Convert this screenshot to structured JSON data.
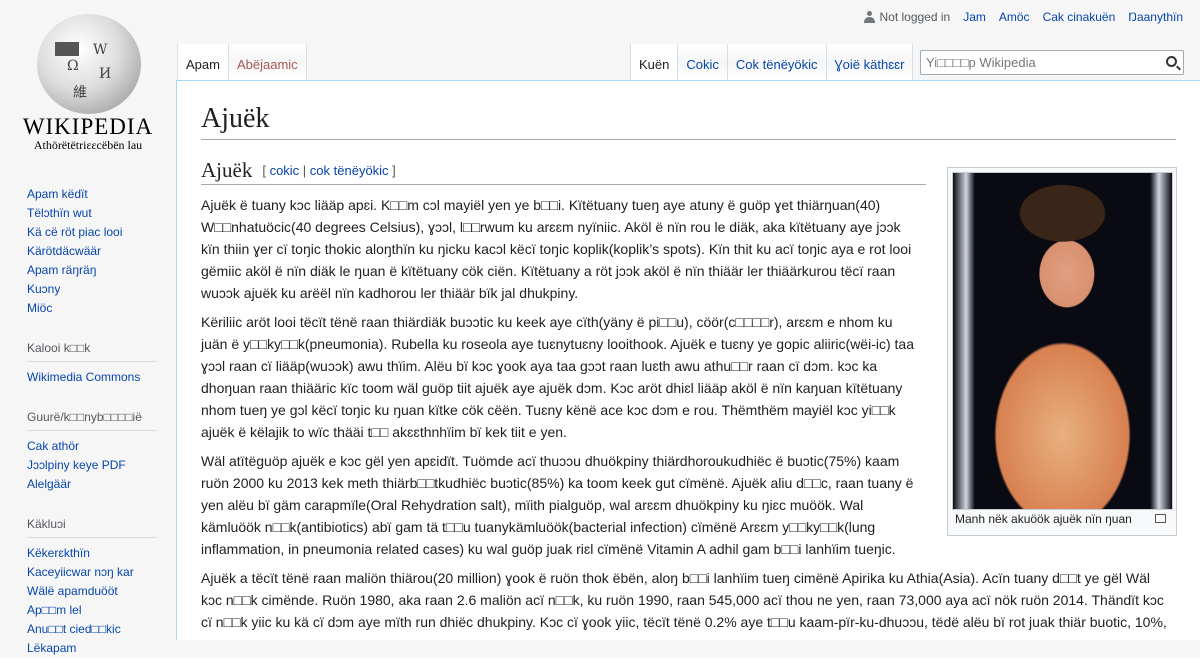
{
  "logo": {
    "wordmark": "WIKIPEDIA",
    "tagline": "Athörëtëtriɛɛcëbën lau"
  },
  "user_bar": {
    "not_logged_in": "Not logged in",
    "links": [
      "Jam",
      "Amöc",
      "Cak cinakuën",
      "Ŋaanythïn"
    ]
  },
  "left_tabs": [
    {
      "label": "Apam",
      "selected": true
    },
    {
      "label": "Abëjaamic",
      "selected": false
    }
  ],
  "right_tabs": [
    {
      "label": "Kuën",
      "selected": true
    },
    {
      "label": "Cokic"
    },
    {
      "label": "Cok tënëyökic"
    },
    {
      "label": "Ɣoië käthɛɛr"
    }
  ],
  "search": {
    "placeholder": "Yi□□□□p Wikipedia"
  },
  "sidebar": {
    "nav": [
      "Apam këdït",
      "Tëlɔthïn wut",
      "Kä cë röt piac looi",
      "Kärötdäcwäär",
      "Apam räŋräŋ",
      "Kuɔny",
      "Miöc"
    ],
    "sections": [
      {
        "heading": "Kalooi k□□k",
        "items": [
          "Wikimedia Commons"
        ]
      },
      {
        "heading": "Guurë/k□□nyb□□□□ië",
        "items": [
          "Cak athör",
          "Jɔɔlpiny keye PDF",
          "Alelgäär"
        ]
      },
      {
        "heading": "Käkluɔi",
        "items": [
          "Këkerɛkthïn",
          "Kaceyiicwar nɔŋ kar",
          "Wälë apamduööt",
          "Ap□□m lel",
          "Anu□□t cied□□kic",
          "Lëkapam"
        ]
      }
    ]
  },
  "article": {
    "title": "Ajuëk",
    "section_heading": "Ajuëk",
    "edit_links": {
      "edit": "cokic",
      "edit_source": "cok tënëyökic"
    },
    "paragraphs": [
      [
        "Ajuëk ë tuany kɔc liääp apɛi. K□□m cɔl mayiël yen ye b□□i. Kïtëtuany tueŋ aye atuny ë guöp ɣet thiärŋuan(40)",
        "W□□nhatuöcic(40 degrees Celsius), ɣɔɔl, l□□rwum ku arɛɛm nyïniic. Aköl ë nïn rou le diäk, aka kïtëtuany aye jɔɔk",
        "kïn thiin ɣer cï toŋic thokic aloŋthïn ku ŋicku kacɔl këcï toŋic koplik(koplik’s spots). Kïn thit ku acï toŋic aya e rot looi",
        "gëmiic aköl ë nïn diäk le ŋuan ë kïtëtuany cök ciën. Kïtëtuany a röt jɔɔk aköl ë nïn thiäär ler thiäärkurou tëcï raan",
        "wuɔɔk ajuëk ku arëël nïn kadhorou ler thiäär bïk jal dhukpiny."
      ],
      [
        "Këriliic aröt looi tëcït tënë raan thiärdiäk buɔɔtic ku keek aye cïth(yäny ë pi□□u), cöör(c□□□□r), arɛɛm e nhom ku",
        "juän ë y□□ky□□k(pneumonia). Rubella ku roseola aye tuɛnytuɛny looithook. Ajuëk e tuɛny ye gopic aliiric(wëi-ic) taa",
        "ɣɔɔl raan cï liääp(wuɔɔk) awu thïim. Alëu bï kɔc ɣook aya taa gɔɔt raan luɛth awu athu□□r raan cï dɔm. kɔc ka",
        "dhoŋuan raan thiääric kïc toom wäl guöp tiit ajuëk aye ajuëk dɔm. Kɔc aröt dhiɛl liääp aköl ë nïn kaŋuan kïtëtuany",
        "nhom tueŋ ye gɔl këcï toŋic ku ŋuan kïtke cök cëën. Tuɛny kënë ace kɔc dɔm e rou. Thëmthëm mayiël kɔc yi□□k",
        "ajuëk ë këlajik to wïc thääi t□□ akɛɛthnhïim bï kek tiit e yen."
      ],
      [
        "Wäl atïtëguöp ajuëk e kɔc gël yen apɛidït. Tuömde acï thuɔɔu dhuökpiny thiärdhoroukudhiëc ë buɔtic(75%) kaam",
        "ruön 2000 ku 2013 kek meth thiärb□□tkudhiëc buɔtic(85%) ka toom keek gut cïmënë. Ajuëk aliu d□□c, raan tuany ë",
        "yen alëu bï gäm carapmïle(Oral Rehydration salt), mïith pialguöp, wal arɛɛm dhuökpiny ku ŋiɛc muöök. Wal",
        "kämluöök n□□k(antibiotics) abï gam tä t□□u tuanykämluöök(bacterial infection) cïmënë Arɛɛm y□□ky□□k(lung",
        "inflammation, in pneumonia related cases) ku wal guöp juak riɛl cïmënë Vitamin A adhil gam b□□i lanhïim tueŋic."
      ],
      [
        "Ajuëk a tëcït tënë raan maliön thiärou(20 million) ɣook ë ruön thok ëbën, aloŋ b□□i lanhïim tueŋ cimënë Apirika ku Athia(Asia). Acïn tuany d□□t ye gël Wäl",
        "kɔc n□□k cimënde. Ruön 1980, aka raan 2.6 maliön acï n□□k, ku ruön 1990, raan 545,000 acï thou ne yen, raan 73,000 aya acï nök ruön 2014. Thändït kɔc",
        "cï n□□k yiic ku kä cï dɔm aye mïth run dhiëc dhukpiny. Kɔc cï ɣook yiic, tëcït tënë 0.2% aye t□□u kaam-pïr-ku-dhuɔɔu, tëdë alëu bï rot juak thiär buotic, 10%,"
      ]
    ],
    "image_caption": "Manh nëk akuöök ajuëk nïn ŋuan"
  }
}
